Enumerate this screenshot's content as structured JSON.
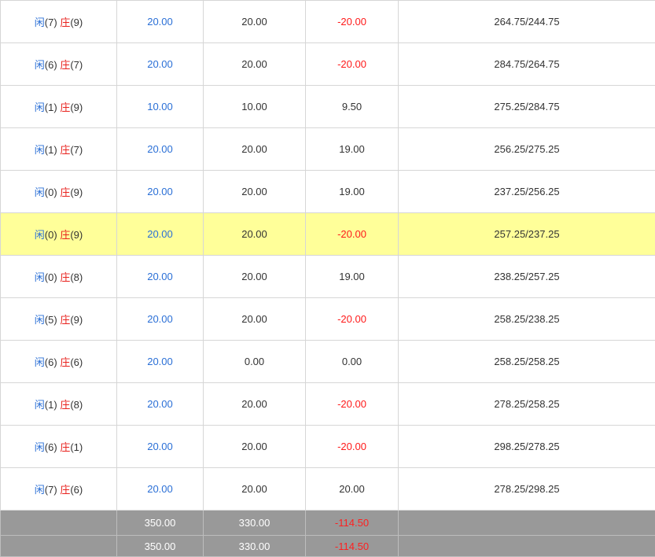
{
  "rows": [
    {
      "player_label": "闲",
      "player_score": "(7)",
      "banker_label": "庄",
      "banker_score": "(9)",
      "bet": "20.00",
      "valid": "20.00",
      "winloss": "-20.00",
      "balance": "264.75/244.75",
      "highlight": false
    },
    {
      "player_label": "闲",
      "player_score": "(6)",
      "banker_label": "庄",
      "banker_score": "(7)",
      "bet": "20.00",
      "valid": "20.00",
      "winloss": "-20.00",
      "balance": "284.75/264.75",
      "highlight": false
    },
    {
      "player_label": "闲",
      "player_score": "(1)",
      "banker_label": "庄",
      "banker_score": "(9)",
      "bet": "10.00",
      "valid": "10.00",
      "winloss": "9.50",
      "balance": "275.25/284.75",
      "highlight": false
    },
    {
      "player_label": "闲",
      "player_score": "(1)",
      "banker_label": "庄",
      "banker_score": "(7)",
      "bet": "20.00",
      "valid": "20.00",
      "winloss": "19.00",
      "balance": "256.25/275.25",
      "highlight": false
    },
    {
      "player_label": "闲",
      "player_score": "(0)",
      "banker_label": "庄",
      "banker_score": "(9)",
      "bet": "20.00",
      "valid": "20.00",
      "winloss": "19.00",
      "balance": "237.25/256.25",
      "highlight": false
    },
    {
      "player_label": "闲",
      "player_score": "(0)",
      "banker_label": "庄",
      "banker_score": "(9)",
      "bet": "20.00",
      "valid": "20.00",
      "winloss": "-20.00",
      "balance": "257.25/237.25",
      "highlight": true
    },
    {
      "player_label": "闲",
      "player_score": "(0)",
      "banker_label": "庄",
      "banker_score": "(8)",
      "bet": "20.00",
      "valid": "20.00",
      "winloss": "19.00",
      "balance": "238.25/257.25",
      "highlight": false
    },
    {
      "player_label": "闲",
      "player_score": "(5)",
      "banker_label": "庄",
      "banker_score": "(9)",
      "bet": "20.00",
      "valid": "20.00",
      "winloss": "-20.00",
      "balance": "258.25/238.25",
      "highlight": false
    },
    {
      "player_label": "闲",
      "player_score": "(6)",
      "banker_label": "庄",
      "banker_score": "(6)",
      "bet": "20.00",
      "valid": "0.00",
      "winloss": "0.00",
      "balance": "258.25/258.25",
      "highlight": false
    },
    {
      "player_label": "闲",
      "player_score": "(1)",
      "banker_label": "庄",
      "banker_score": "(8)",
      "bet": "20.00",
      "valid": "20.00",
      "winloss": "-20.00",
      "balance": "278.25/258.25",
      "highlight": false
    },
    {
      "player_label": "闲",
      "player_score": "(6)",
      "banker_label": "庄",
      "banker_score": "(1)",
      "bet": "20.00",
      "valid": "20.00",
      "winloss": "-20.00",
      "balance": "298.25/278.25",
      "highlight": false
    },
    {
      "player_label": "闲",
      "player_score": "(7)",
      "banker_label": "庄",
      "banker_score": "(6)",
      "bet": "20.00",
      "valid": "20.00",
      "winloss": "20.00",
      "balance": "278.25/298.25",
      "highlight": false
    }
  ],
  "totals": [
    {
      "bet": "350.00",
      "valid": "330.00",
      "winloss": "-114.50"
    },
    {
      "bet": "350.00",
      "valid": "330.00",
      "winloss": "-114.50"
    }
  ],
  "colors": {
    "player": "#2a6fd6",
    "banker": "#e8221d",
    "negative": "#ff1a1a",
    "highlight_row": "#ffff99",
    "total_bg": "#999999"
  }
}
